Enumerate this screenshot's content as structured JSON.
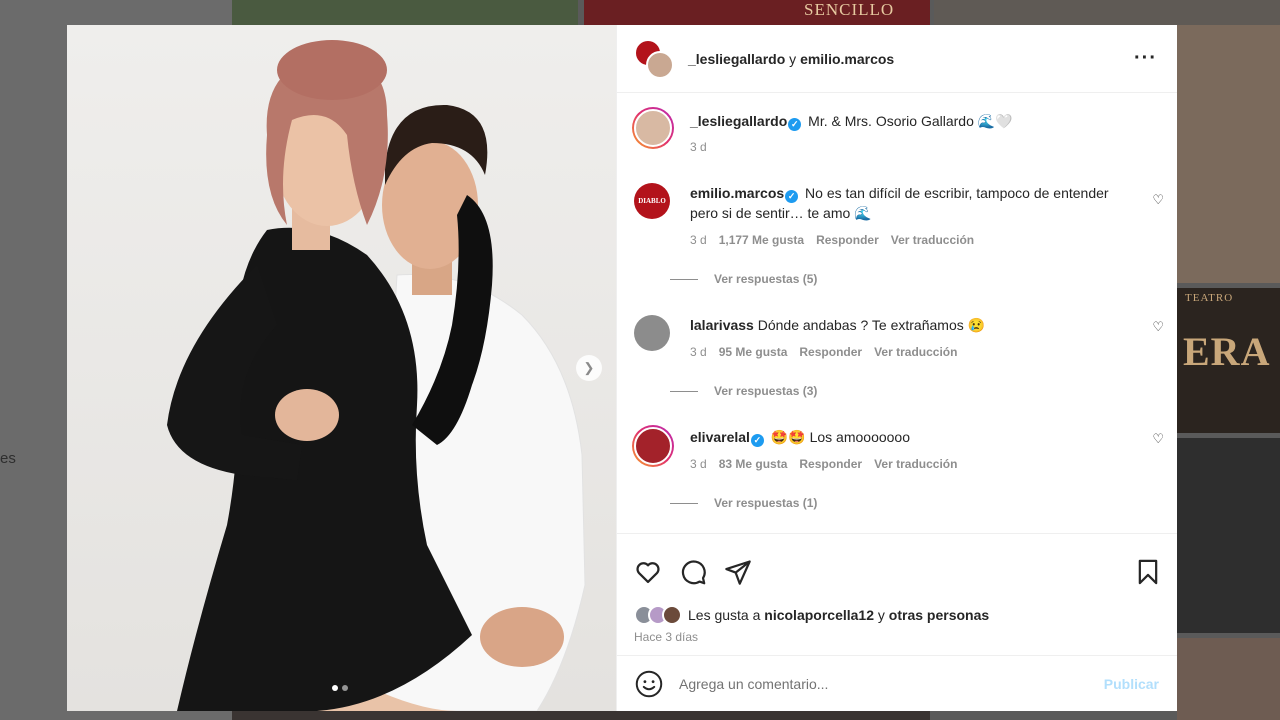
{
  "background": {
    "left_text": "es",
    "tile_labels": [
      "SENCILLO",
      "TEATRO",
      "ERA"
    ]
  },
  "post": {
    "header": {
      "user1": "_lesliegallardo",
      "conjunction": "y",
      "user2": "emilio.marcos"
    },
    "caption": {
      "username": "_lesliegallardo",
      "text": "Mr. & Mrs. Osorio Gallardo 🌊🤍",
      "time": "3 d"
    },
    "comments": [
      {
        "username": "emilio.marcos",
        "verified": true,
        "text": "No es tan difícil de escribir, tampoco de entender pero si de sentir… te amo 🌊",
        "time": "3 d",
        "likes": "1,177 Me gusta",
        "reply": "Responder",
        "translate": "Ver traducción",
        "view_replies": "Ver respuestas (5)",
        "avatar_label": "DIABLO"
      },
      {
        "username": "lalarivass",
        "verified": false,
        "text": "Dónde andabas ? Te extrañamos 😢",
        "time": "3 d",
        "likes": "95 Me gusta",
        "reply": "Responder",
        "translate": "Ver traducción",
        "view_replies": "Ver respuestas (3)"
      },
      {
        "username": "elivarelal",
        "verified": true,
        "text": "🤩🤩 Los amooooooo",
        "time": "3 d",
        "likes": "83 Me gusta",
        "reply": "Responder",
        "translate": "Ver traducción",
        "view_replies": "Ver respuestas (1)"
      }
    ],
    "likes": {
      "prefix": "Les gusta a",
      "user": "nicolaporcella12",
      "middle": "y",
      "others": "otras personas"
    },
    "posted": "Hace 3 días",
    "input": {
      "placeholder": "Agrega un comentario...",
      "publish": "Publicar"
    },
    "carousel": {
      "count": 2,
      "active": 1
    }
  },
  "colors": {
    "verified": "#1d9bf0",
    "publish_disabled": "#b2dffc",
    "muted": "#8e8e8e"
  },
  "icons": [
    "more-icon",
    "heart-icon",
    "comment-icon",
    "share-icon",
    "bookmark-icon",
    "emoji-icon",
    "chevron-right-icon",
    "verified-icon"
  ]
}
